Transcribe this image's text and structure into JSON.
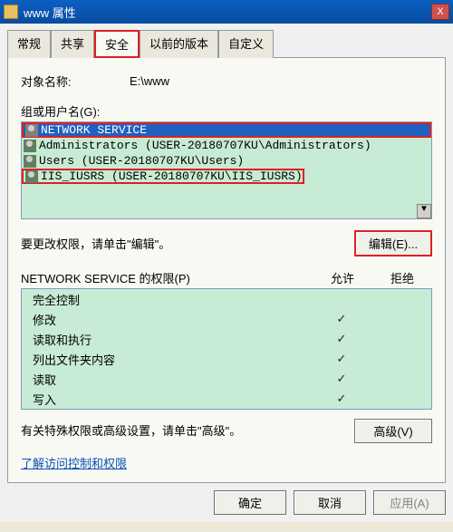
{
  "window": {
    "title": "www 属性",
    "close": "X"
  },
  "tabs": {
    "general": "常规",
    "sharing": "共享",
    "security": "安全",
    "previous": "以前的版本",
    "custom": "自定义"
  },
  "object": {
    "label": "对象名称:",
    "value": "E:\\www"
  },
  "groups": {
    "label": "组或用户名(G):",
    "items": [
      "NETWORK SERVICE",
      "Administrators (USER-20180707KU\\Administrators)",
      "Users (USER-20180707KU\\Users)",
      "IIS_IUSRS (USER-20180707KU\\IIS_IUSRS)"
    ]
  },
  "edit": {
    "text": "要更改权限，请单击\"编辑\"。",
    "button": "编辑(E)..."
  },
  "perm": {
    "header_label": "NETWORK SERVICE 的权限(P)",
    "col_allow": "允许",
    "col_deny": "拒绝",
    "rows": [
      {
        "name": "完全控制",
        "allow": "",
        "deny": ""
      },
      {
        "name": "修改",
        "allow": "✓",
        "deny": ""
      },
      {
        "name": "读取和执行",
        "allow": "✓",
        "deny": ""
      },
      {
        "name": "列出文件夹内容",
        "allow": "✓",
        "deny": ""
      },
      {
        "name": "读取",
        "allow": "✓",
        "deny": ""
      },
      {
        "name": "写入",
        "allow": "✓",
        "deny": ""
      }
    ]
  },
  "advanced": {
    "text": "有关特殊权限或高级设置，请单击\"高级\"。",
    "button": "高级(V)"
  },
  "link": "了解访问控制和权限",
  "buttons": {
    "ok": "确定",
    "cancel": "取消",
    "apply": "应用(A)"
  },
  "scroll_glyph": "▼"
}
